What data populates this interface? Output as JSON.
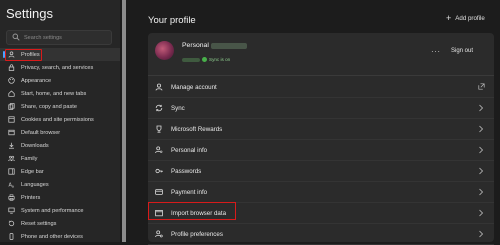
{
  "sidebar": {
    "title": "Settings",
    "search": {
      "placeholder": "Search settings",
      "value": ""
    },
    "items": [
      {
        "label": "Profiles",
        "icon": "profile-icon",
        "active": true
      },
      {
        "label": "Privacy, search, and services",
        "icon": "lock-icon"
      },
      {
        "label": "Appearance",
        "icon": "appearance-icon"
      },
      {
        "label": "Start, home, and new tabs",
        "icon": "home-icon"
      },
      {
        "label": "Share, copy and paste",
        "icon": "share-icon"
      },
      {
        "label": "Cookies and site permissions",
        "icon": "cookie-icon"
      },
      {
        "label": "Default browser",
        "icon": "browser-icon"
      },
      {
        "label": "Downloads",
        "icon": "download-icon"
      },
      {
        "label": "Family",
        "icon": "family-icon"
      },
      {
        "label": "Edge bar",
        "icon": "edge-bar-icon"
      },
      {
        "label": "Languages",
        "icon": "languages-icon"
      },
      {
        "label": "Printers",
        "icon": "printer-icon"
      },
      {
        "label": "System and performance",
        "icon": "system-icon"
      },
      {
        "label": "Reset settings",
        "icon": "reset-icon"
      },
      {
        "label": "Phone and other devices",
        "icon": "phone-icon"
      }
    ]
  },
  "main": {
    "title": "Your profile",
    "add_profile_label": "Add profile",
    "profile": {
      "name": "Personal",
      "sync_status": "Sync is on",
      "more_label": "···",
      "sign_out_label": "Sign out"
    },
    "rows": [
      {
        "label": "Manage account",
        "icon": "person-icon",
        "trailing": "external-link-icon"
      },
      {
        "label": "Sync",
        "icon": "sync-icon",
        "trailing": "chevron-right-icon"
      },
      {
        "label": "Microsoft Rewards",
        "icon": "trophy-icon",
        "trailing": "chevron-right-icon"
      },
      {
        "label": "Personal info",
        "icon": "key-person-icon",
        "trailing": "chevron-right-icon"
      },
      {
        "label": "Passwords",
        "icon": "key-icon",
        "trailing": "chevron-right-icon"
      },
      {
        "label": "Payment info",
        "icon": "card-icon",
        "trailing": "chevron-right-icon"
      },
      {
        "label": "Import browser data",
        "icon": "import-icon",
        "trailing": "chevron-right-icon"
      },
      {
        "label": "Profile preferences",
        "icon": "preferences-icon",
        "trailing": "chevron-right-icon"
      }
    ]
  },
  "colors": {
    "highlight_outline": "#d81b1b",
    "accent": "#4aa3ff",
    "sync_green": "#48b04a"
  }
}
